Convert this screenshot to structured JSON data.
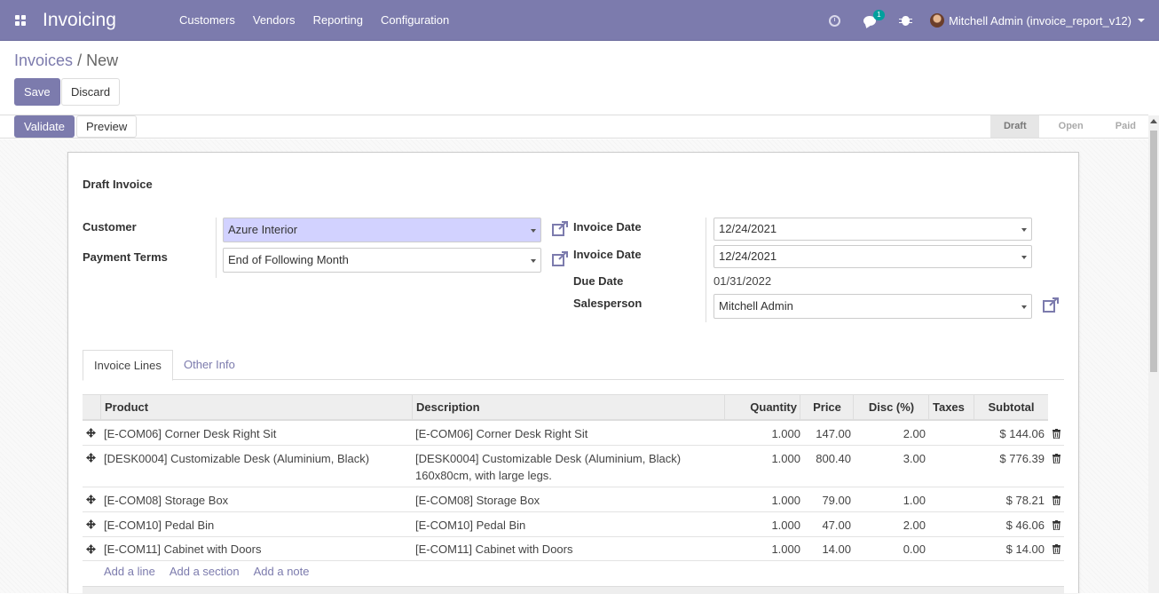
{
  "navbar": {
    "app_title": "Invoicing",
    "menu": [
      "Customers",
      "Vendors",
      "Reporting",
      "Configuration"
    ],
    "messages_count": "1",
    "user_label": "Mitchell Admin (invoice_report_v12)"
  },
  "breadcrumb": {
    "parent": "Invoices",
    "separator": "/",
    "current": "New"
  },
  "buttons": {
    "save": "Save",
    "discard": "Discard",
    "validate": "Validate",
    "preview": "Preview"
  },
  "statusbar": [
    "Draft",
    "Open",
    "Paid"
  ],
  "form": {
    "title": "Draft Invoice",
    "customer_label": "Customer",
    "customer_value": "Azure Interior",
    "payment_terms_label": "Payment Terms",
    "payment_terms_value": "End of Following Month",
    "invoice_date_label": "Invoice Date",
    "invoice_date_value": "12/24/2021",
    "invoice_date2_label": "Invoice Date",
    "invoice_date2_value": "12/24/2021",
    "due_date_label": "Due Date",
    "due_date_value": "01/31/2022",
    "salesperson_label": "Salesperson",
    "salesperson_value": "Mitchell Admin"
  },
  "tabs": {
    "invoice_lines": "Invoice Lines",
    "other_info": "Other Info"
  },
  "table": {
    "headers": [
      "Product",
      "Description",
      "Quantity",
      "Price",
      "Disc (%)",
      "Taxes",
      "Subtotal"
    ],
    "rows": [
      {
        "product": "[E-COM06] Corner Desk Right Sit",
        "desc1": "[E-COM06] Corner Desk Right Sit",
        "desc2": "",
        "qty": "1.000",
        "price": "147.00",
        "disc": "2.00",
        "taxes": "",
        "subtotal": "$ 144.06"
      },
      {
        "product": "[DESK0004] Customizable Desk (Aluminium, Black)",
        "desc1": "[DESK0004] Customizable Desk (Aluminium, Black)",
        "desc2": "160x80cm, with large legs.",
        "qty": "1.000",
        "price": "800.40",
        "disc": "3.00",
        "taxes": "",
        "subtotal": "$ 776.39"
      },
      {
        "product": "[E-COM08] Storage Box",
        "desc1": "[E-COM08] Storage Box",
        "desc2": "",
        "qty": "1.000",
        "price": "79.00",
        "disc": "1.00",
        "taxes": "",
        "subtotal": "$ 78.21"
      },
      {
        "product": "[E-COM10] Pedal Bin",
        "desc1": "[E-COM10] Pedal Bin",
        "desc2": "",
        "qty": "1.000",
        "price": "47.00",
        "disc": "2.00",
        "taxes": "",
        "subtotal": "$ 46.06"
      },
      {
        "product": "[E-COM11] Cabinet with Doors",
        "desc1": "[E-COM11] Cabinet with Doors",
        "desc2": "",
        "qty": "1.000",
        "price": "14.00",
        "disc": "0.00",
        "taxes": "",
        "subtotal": "$ 14.00"
      }
    ],
    "add_links": {
      "line": "Add a line",
      "section": "Add a section",
      "note": "Add a note"
    }
  },
  "colors": {
    "brand": "#7c7bad",
    "highlight": "#d2d2ff"
  }
}
